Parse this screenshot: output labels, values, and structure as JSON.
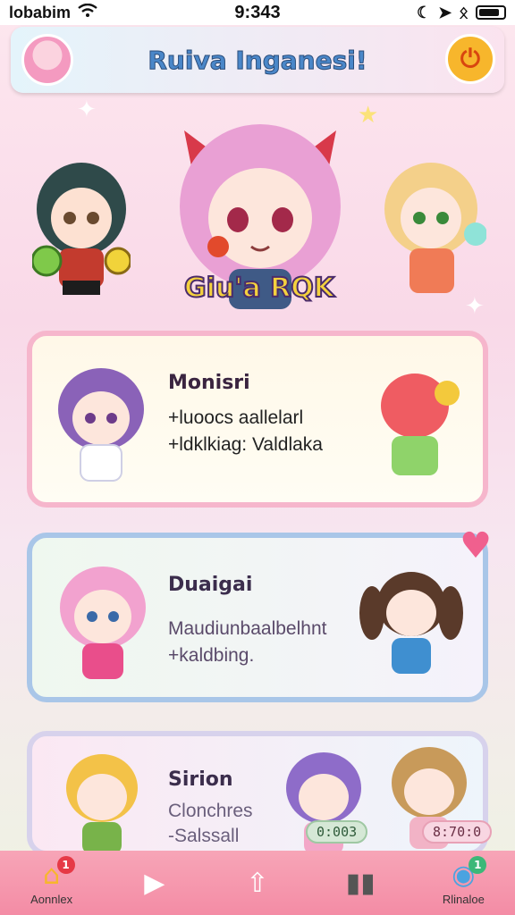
{
  "status_bar": {
    "carrier": "lobabim",
    "time": "9:343"
  },
  "header": {
    "title": "Ruiva Inganesi!"
  },
  "hero": {
    "label": "Giu'a RQK"
  },
  "cards": [
    {
      "title": "Monisri",
      "lines": [
        "+luoocs aallelarl",
        "+ldklkiag: Valdlaka"
      ]
    },
    {
      "title": "Duaigai",
      "lines": [
        "Maudiunbaalbelhnt",
        "+kaldbing."
      ]
    },
    {
      "title": "Sirion",
      "lines": [
        "Clonchres",
        "-Salssall"
      ],
      "pills": [
        "0:003",
        "8:70:0"
      ]
    }
  ],
  "nav": {
    "items": [
      {
        "label": "Aonnlex",
        "icon": "home-icon",
        "badge": "1"
      },
      {
        "label": "",
        "icon": "play-icon"
      },
      {
        "label": "",
        "icon": "share-icon"
      },
      {
        "label": "",
        "icon": "book-icon"
      },
      {
        "label": "Rlinaloe",
        "icon": "chat-icon",
        "badge": "1"
      }
    ]
  },
  "colors": {
    "accent": "#f48ca5",
    "header_title": "#4a87c9",
    "card1_border": "#f6b6cc",
    "card2_border": "#a9c6e8"
  }
}
